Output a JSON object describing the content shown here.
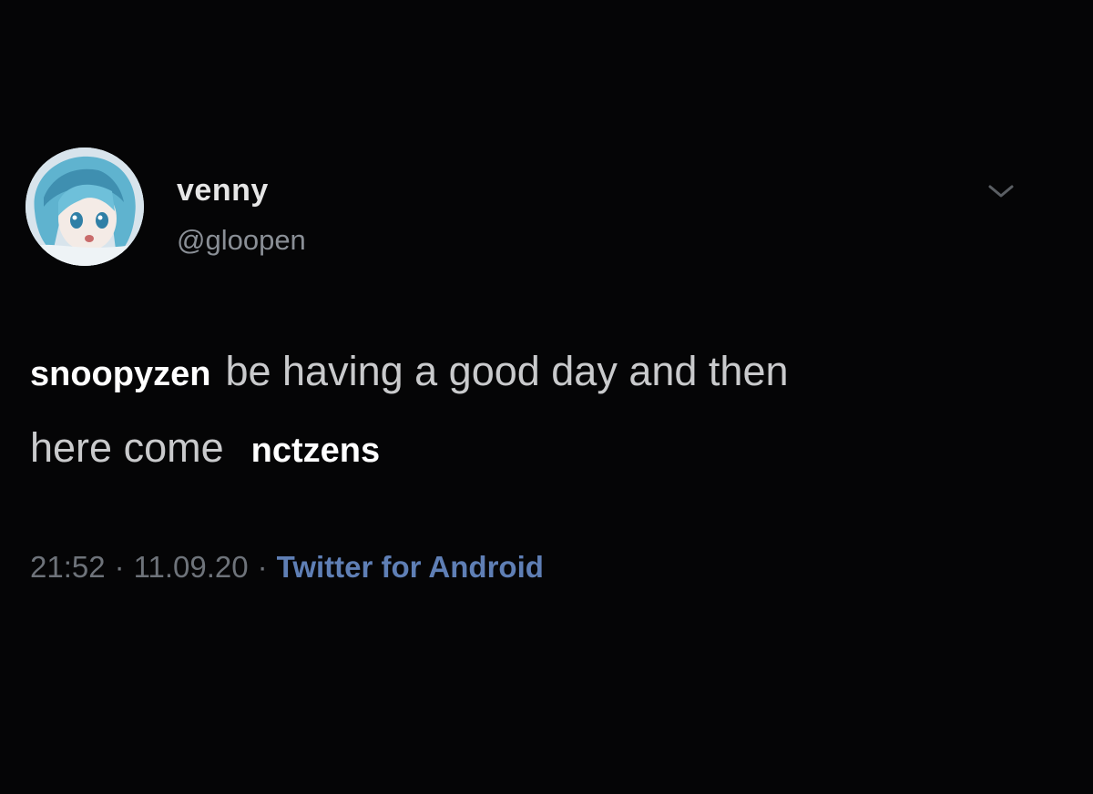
{
  "tweet": {
    "author": {
      "display_name": "venny",
      "handle": "@gloopen",
      "avatar_icon": "anime-avatar"
    },
    "menu_icon": "chevron-down-icon",
    "text": {
      "line1_overlay": "snoopyzen",
      "line1_rest": "be having a good day and then",
      "line2_rest": "here come",
      "line2_overlay": "nctzens"
    },
    "meta": {
      "time": "21:52",
      "separator": "·",
      "date": "11.09.20",
      "source": "Twitter for Android"
    }
  },
  "colors": {
    "background": "#050506",
    "text": "#c9cacc",
    "overlay_text": "#ffffff",
    "handle": "#8a8f96",
    "source_link": "#5f7fb5"
  }
}
